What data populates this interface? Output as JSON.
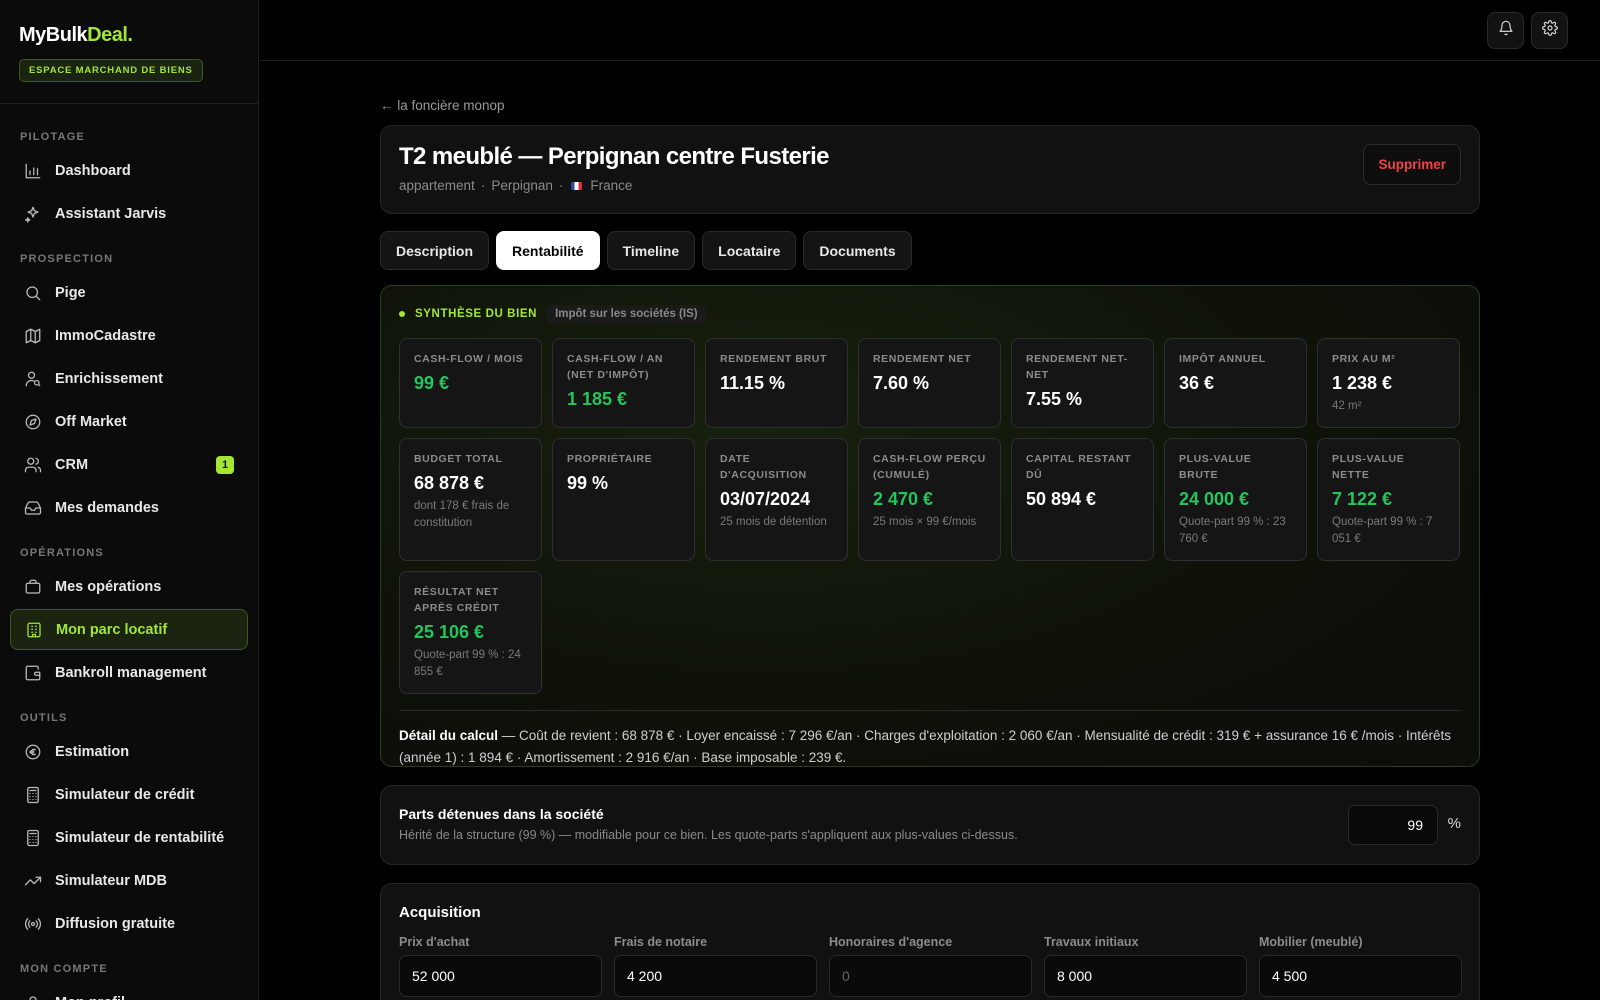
{
  "brand": {
    "logo_main": "MyBulk",
    "logo_accent": "Deal.",
    "badge": "ESPACE MARCHAND DE BIENS"
  },
  "colors": {
    "accent": "#a3e635",
    "positive": "#22c55e",
    "danger": "#ef4444"
  },
  "sidebar": {
    "sections": [
      {
        "title": "PILOTAGE",
        "items": [
          {
            "label": "Dashboard",
            "icon": "chart-bar-icon"
          },
          {
            "label": "Assistant Jarvis",
            "icon": "sparkles-icon"
          }
        ]
      },
      {
        "title": "PROSPECTION",
        "items": [
          {
            "label": "Pige",
            "icon": "search-icon"
          },
          {
            "label": "ImmoCadastre",
            "icon": "map-icon"
          },
          {
            "label": "Enrichissement",
            "icon": "user-search-icon"
          },
          {
            "label": "Off Market",
            "icon": "compass-icon"
          },
          {
            "label": "CRM",
            "icon": "users-icon",
            "badge": "1"
          },
          {
            "label": "Mes demandes",
            "icon": "inbox-icon"
          }
        ]
      },
      {
        "title": "OPÉRATIONS",
        "items": [
          {
            "label": "Mes opérations",
            "icon": "briefcase-icon"
          },
          {
            "label": "Mon parc locatif",
            "icon": "building-icon",
            "active": true
          },
          {
            "label": "Bankroll management",
            "icon": "wallet-icon"
          }
        ]
      },
      {
        "title": "OUTILS",
        "items": [
          {
            "label": "Estimation",
            "icon": "euro-icon"
          },
          {
            "label": "Simulateur de crédit",
            "icon": "calculator-icon"
          },
          {
            "label": "Simulateur de rentabilité",
            "icon": "calculator-icon"
          },
          {
            "label": "Simulateur MDB",
            "icon": "trending-up-icon"
          },
          {
            "label": "Diffusion gratuite",
            "icon": "broadcast-icon"
          }
        ]
      },
      {
        "title": "MON COMPTE",
        "items": [
          {
            "label": "Mon profil",
            "icon": "user-icon"
          }
        ]
      }
    ]
  },
  "topbar": {
    "icons": [
      "bell-icon",
      "gear-icon"
    ]
  },
  "page": {
    "back_link": "← la foncière monop",
    "title": "T2 meublé — Perpignan centre Fusterie",
    "subtitle_type": "appartement",
    "subtitle_city": "Perpignan",
    "subtitle_country": "France",
    "sep": "·",
    "delete_label": "Supprimer"
  },
  "tabs": [
    {
      "label": "Description"
    },
    {
      "label": "Rentabilité",
      "active": true
    },
    {
      "label": "Timeline"
    },
    {
      "label": "Locataire"
    },
    {
      "label": "Documents"
    }
  ],
  "synthese": {
    "label": "SYNTHÈSE DU BIEN",
    "tag": "Impôt sur les sociétés (IS)",
    "kpis": [
      {
        "label": "CASH-FLOW / MOIS",
        "value": "99 €",
        "green": true
      },
      {
        "label": "CASH-FLOW / AN (NET D'IMPÔT)",
        "value": "1 185 €",
        "green": true
      },
      {
        "label": "RENDEMENT BRUT",
        "value": "11.15 %"
      },
      {
        "label": "RENDEMENT NET",
        "value": "7.60 %"
      },
      {
        "label": "RENDEMENT NET-NET",
        "value": "7.55 %"
      },
      {
        "label": "IMPÔT ANNUEL",
        "value": "36 €"
      },
      {
        "label": "PRIX AU M²",
        "value": "1 238 €",
        "note": "42 m²"
      },
      {
        "label": "BUDGET TOTAL",
        "value": "68 878 €",
        "note": "dont 178 € frais de constitution"
      },
      {
        "label": "PROPRIÉTAIRE",
        "value": "99 %"
      },
      {
        "label": "DATE D'ACQUISITION",
        "value": "03/07/2024",
        "note": "25 mois de détention"
      },
      {
        "label": "CASH-FLOW PERÇU (CUMULÉ)",
        "value": "2 470 €",
        "green": true,
        "note": "25 mois × 99 €/mois"
      },
      {
        "label": "CAPITAL RESTANT DÛ",
        "value": "50 894 €"
      },
      {
        "label": "PLUS-VALUE BRUTE",
        "value": "24 000 €",
        "green": true,
        "note": "Quote-part 99 % : 23 760 €"
      },
      {
        "label": "PLUS-VALUE NETTE",
        "value": "7 122 €",
        "green": true,
        "note": "Quote-part 99 % : 7 051 €"
      },
      {
        "label": "RÉSULTAT NET APRÈS CRÉDIT",
        "value": "25 106 €",
        "green": true,
        "note": "Quote-part 99 % : 24 855 €"
      }
    ],
    "calc_label": "Détail du calcul",
    "calc_text": " — Coût de revient : 68 878 € · Loyer encaissé : 7 296 €/an · Charges d'exploitation : 2 060 €/an · Mensualité de crédit : 319 € + assurance 16 € /mois · Intérêts (année 1) : 1 894 € · Amortissement : 2 916 €/an · Base imposable : 239 €."
  },
  "parts": {
    "title": "Parts détenues dans la société",
    "subtitle": "Hérité de la structure (99 %) — modifiable pour ce bien. Les quote-parts s'appliquent aux plus-values ci-dessus.",
    "value": "99",
    "unit": "%"
  },
  "acquisition": {
    "title": "Acquisition",
    "fields": [
      {
        "label": "Prix d'achat",
        "value": "52 000"
      },
      {
        "label": "Frais de notaire",
        "value": "4 200"
      },
      {
        "label": "Honoraires d'agence",
        "value": "",
        "placeholder": "0"
      },
      {
        "label": "Travaux initiaux",
        "value": "8 000"
      },
      {
        "label": "Mobilier (meublé)",
        "value": "4 500"
      }
    ]
  }
}
